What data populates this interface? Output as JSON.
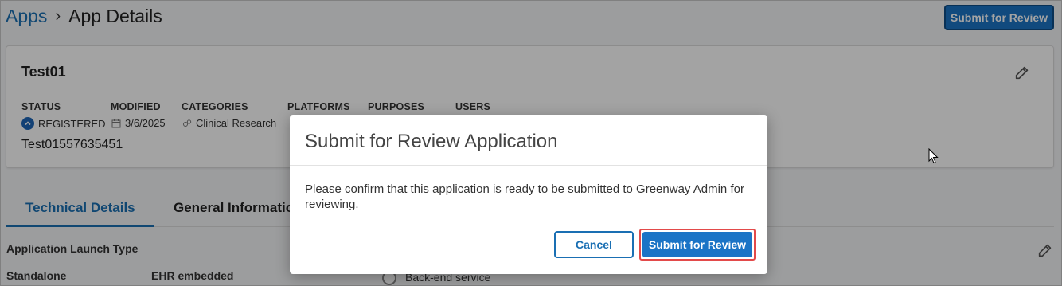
{
  "breadcrumb": {
    "root": "Apps",
    "separator": "›",
    "current": "App Details"
  },
  "header": {
    "submit_label": "Submit for Review"
  },
  "app": {
    "name": "Test01",
    "client_id": "Test01557635451",
    "meta": {
      "status": {
        "label": "STATUS",
        "value": "REGISTERED"
      },
      "modified": {
        "label": "MODIFIED",
        "value": "3/6/2025"
      },
      "categories": {
        "label": "CATEGORIES",
        "value": "Clinical Research"
      },
      "platforms": {
        "label": "PLATFORMS"
      },
      "purposes": {
        "label": "PURPOSES"
      },
      "users": {
        "label": "USERS"
      }
    }
  },
  "tabs": [
    {
      "label": "Technical Details",
      "active": true
    },
    {
      "label": "General Information",
      "active": false
    }
  ],
  "technical": {
    "launch_type_label": "Application Launch Type",
    "options": [
      "Standalone",
      "EHR embedded",
      "Back-end service"
    ]
  },
  "modal": {
    "title": "Submit for Review Application",
    "body": "Please confirm that this application is ready to be submitted to Greenway Admin for reviewing.",
    "cancel_label": "Cancel",
    "submit_label": "Submit for Review"
  },
  "colors": {
    "accent": "#1a6fb3",
    "primary_button": "#1b74c6",
    "highlight": "#e34a4a"
  }
}
